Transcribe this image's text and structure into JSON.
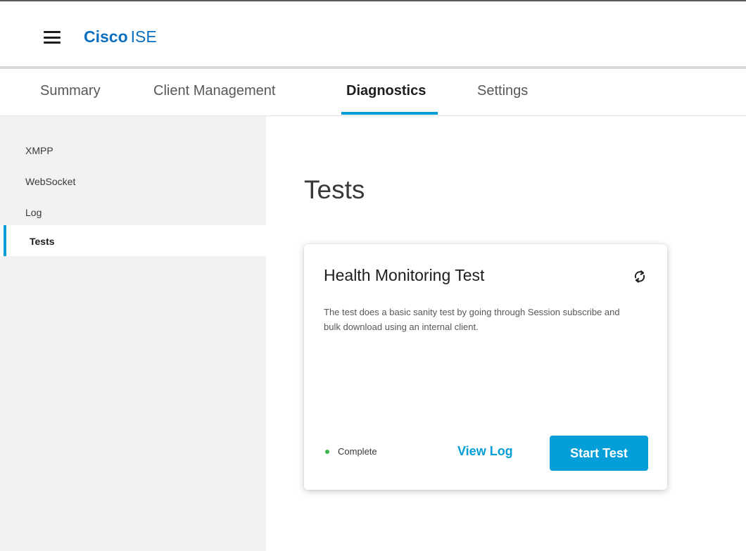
{
  "header": {
    "brand_main": "Cisco",
    "brand_sub": "ISE",
    "menu_icon": "hamburger-menu-icon"
  },
  "tabs": [
    {
      "label": "Summary",
      "active": false
    },
    {
      "label": "Client Management",
      "active": false
    },
    {
      "label": "Diagnostics",
      "active": true
    },
    {
      "label": "Settings",
      "active": false
    }
  ],
  "sidebar": {
    "items": [
      {
        "label": "XMPP",
        "active": false
      },
      {
        "label": "WebSocket",
        "active": false
      },
      {
        "label": "Log",
        "active": false
      },
      {
        "label": "Tests",
        "active": true
      }
    ]
  },
  "main": {
    "title": "Tests",
    "card": {
      "title": "Health Monitoring Test",
      "description": "The test does a basic sanity test by going through Session subscribe and bulk download using an internal client.",
      "status": "Complete",
      "view_log_label": "View Log",
      "start_label": "Start Test",
      "refresh_icon": "refresh-icon"
    }
  },
  "colors": {
    "brand": "#0b6fbf",
    "accent": "#049fd9",
    "status_complete": "#3bb54a",
    "sidebar_bg": "#f2f2f2"
  }
}
